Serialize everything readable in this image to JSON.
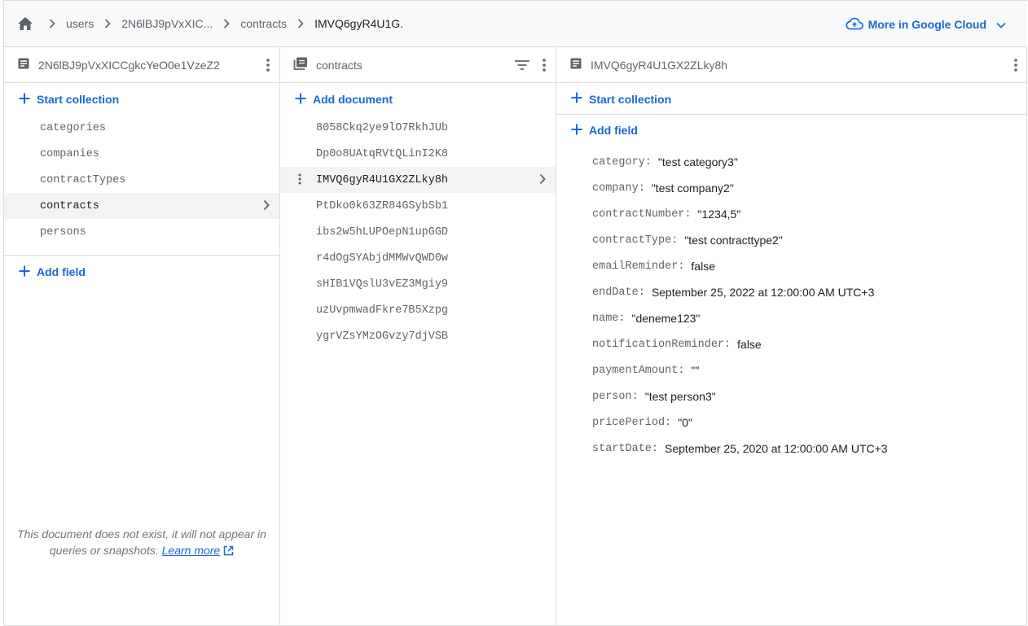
{
  "breadcrumb": [
    {
      "label": "users"
    },
    {
      "label": "2N6lBJ9pVxXIC..."
    },
    {
      "label": "contracts"
    },
    {
      "label": "IMVQ6gyR4U1G."
    }
  ],
  "cloud": {
    "label": "More in Google Cloud"
  },
  "panel1": {
    "title": "2N6lBJ9pVxXICCgkcYeO0e1VzeZ2",
    "start_collection": "Start collection",
    "collections": [
      "categories",
      "companies",
      "contractTypes",
      "contracts",
      "persons"
    ],
    "selected": "contracts",
    "add_field": "Add field",
    "note": "This document does not exist, it will not appear in queries or snapshots.",
    "learn_more": "Learn more"
  },
  "panel2": {
    "title": "contracts",
    "add_document": "Add document",
    "documents": [
      "8058Ckq2ye9lO7RkhJUb",
      "Dp0o8UAtqRVtQLinI2K8",
      "IMVQ6gyR4U1GX2ZLky8h",
      "PtDko0k63ZR84GSybSb1",
      "ibs2w5hLUPOepN1upGGD",
      "r4dOgSYAbjdMMWvQWD0w",
      "sHIB1VQslU3vEZ3Mgiy9",
      "uzUvpmwadFkre7B5Xzpg",
      "ygrVZsYMzOGvzy7djVSB"
    ],
    "selected": "IMVQ6gyR4U1GX2ZLky8h"
  },
  "panel3": {
    "title": "IMVQ6gyR4U1GX2ZLky8h",
    "start_collection": "Start collection",
    "add_field": "Add field",
    "fields": [
      {
        "key": "category:",
        "value": "\"test category3\""
      },
      {
        "key": "company:",
        "value": "\"test company2\""
      },
      {
        "key": "contractNumber:",
        "value": "\"1234,5\""
      },
      {
        "key": "contractType:",
        "value": "\"test contracttype2\""
      },
      {
        "key": "emailReminder:",
        "value": "false"
      },
      {
        "key": "endDate:",
        "value": "September 25, 2022 at 12:00:00 AM UTC+3"
      },
      {
        "key": "name:",
        "value": "\"deneme123\""
      },
      {
        "key": "notificationReminder:",
        "value": "false"
      },
      {
        "key": "paymentAmount:",
        "value": "\"\""
      },
      {
        "key": "person:",
        "value": "\"test person3\""
      },
      {
        "key": "pricePeriod:",
        "value": "\"0\""
      },
      {
        "key": "startDate:",
        "value": "September 25, 2020 at 12:00:00 AM UTC+3"
      }
    ]
  },
  "colors": {
    "accent": "#1967d2",
    "selected_bg": "#f1f3f4",
    "border": "#dadce0"
  }
}
